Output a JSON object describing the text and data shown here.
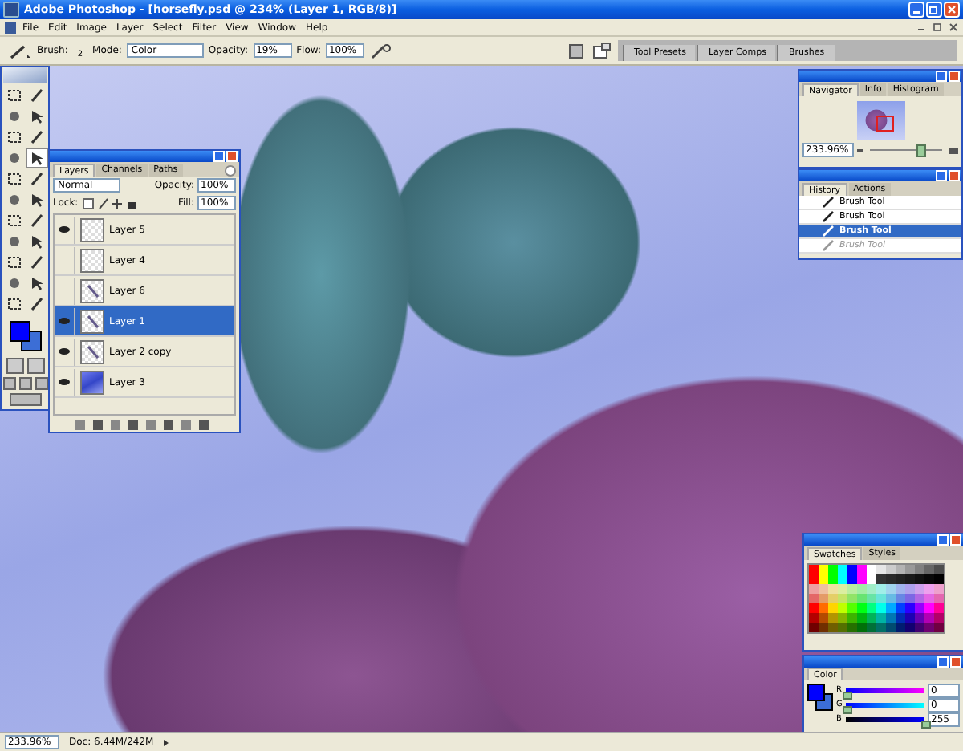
{
  "window": {
    "title": "Adobe Photoshop - [horsefly.psd @ 234% (Layer 1, RGB/8)]"
  },
  "menu": [
    "File",
    "Edit",
    "Image",
    "Layer",
    "Select",
    "Filter",
    "View",
    "Window",
    "Help"
  ],
  "options_bar": {
    "brush_label": "Brush:",
    "brush_size": "2",
    "mode_label": "Mode:",
    "mode": "Color",
    "opacity_label": "Opacity:",
    "opacity": "19%",
    "flow_label": "Flow:",
    "flow": "100%"
  },
  "palette_well": {
    "tabs": [
      "Tool Presets",
      "Layer Comps",
      "Brushes"
    ]
  },
  "layers_panel": {
    "tabs": [
      {
        "label": "Layers",
        "selected": true
      },
      {
        "label": "Channels",
        "selected": false
      },
      {
        "label": "Paths",
        "selected": false
      }
    ],
    "blend_mode": "Normal",
    "opacity_label": "Opacity:",
    "opacity": "100%",
    "lock_label": "Lock:",
    "fill_label": "Fill:",
    "fill": "100%",
    "layers": [
      {
        "name": "Layer 5",
        "visible": true,
        "selected": false,
        "kind": "empty"
      },
      {
        "name": "Layer 4",
        "visible": false,
        "selected": false,
        "kind": "empty"
      },
      {
        "name": "Layer 6",
        "visible": false,
        "selected": false,
        "kind": "sketch"
      },
      {
        "name": "Layer 1",
        "visible": true,
        "selected": true,
        "kind": "sketch"
      },
      {
        "name": "Layer 2 copy",
        "visible": true,
        "selected": false,
        "kind": "sketch"
      },
      {
        "name": "Layer 3",
        "visible": true,
        "selected": false,
        "kind": "sky"
      }
    ]
  },
  "navigator": {
    "tabs": [
      {
        "label": "Navigator",
        "selected": true
      },
      {
        "label": "Info",
        "selected": false
      },
      {
        "label": "Histogram",
        "selected": false
      }
    ],
    "zoom": "233.96%",
    "level": 0.72
  },
  "history": {
    "tabs": [
      {
        "label": "History",
        "selected": true
      },
      {
        "label": "Actions",
        "selected": false
      }
    ],
    "items": [
      {
        "label": "Brush Tool",
        "selected": false,
        "disabled": false
      },
      {
        "label": "Brush Tool",
        "selected": false,
        "disabled": false
      },
      {
        "label": "Brush Tool",
        "selected": true,
        "disabled": false
      },
      {
        "label": "Brush Tool",
        "selected": false,
        "disabled": true
      }
    ]
  },
  "swatches": {
    "tabs": [
      {
        "label": "Swatches",
        "selected": true
      },
      {
        "label": "Styles",
        "selected": false
      }
    ]
  },
  "color_panel": {
    "tabs": [
      {
        "label": "Color",
        "selected": true
      }
    ],
    "channels": [
      {
        "label": "R",
        "value": "0",
        "level": 0
      },
      {
        "label": "G",
        "value": "0",
        "level": 0
      },
      {
        "label": "B",
        "value": "255",
        "level": 1
      }
    ]
  },
  "status_bar": {
    "zoom": "233.96%",
    "doc": "Doc: 6.44M/242M"
  }
}
